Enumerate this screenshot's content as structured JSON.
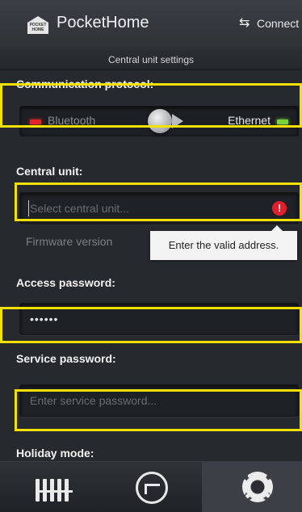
{
  "header": {
    "logo_text": "POCKET HOME",
    "app_title": "PocketHome",
    "connect_label": "Connect"
  },
  "subheader": {
    "title": "Central unit settings"
  },
  "protocol": {
    "label": "Communication protocol:",
    "option_left": "Bluetooth",
    "option_right": "Ethernet",
    "selected": "Ethernet"
  },
  "central_unit": {
    "label": "Central unit:",
    "placeholder": "Select central unit...",
    "firmware_label": "Firmware version",
    "error_tooltip": "Enter the valid address."
  },
  "access_password": {
    "label": "Access password:",
    "value": "••••••"
  },
  "service_password": {
    "label": "Service password:",
    "placeholder": "Enter service password..."
  },
  "holiday": {
    "label": "Holiday mode:"
  },
  "colors": {
    "highlight": "#f5e000",
    "error": "#e3202a",
    "led_off": "#e0262b",
    "led_on": "#7ad23a"
  },
  "bottom_nav": {
    "tabs": [
      {
        "icon": "radiator-icon",
        "active": false
      },
      {
        "icon": "gauge-icon",
        "active": false
      },
      {
        "icon": "gear-icon",
        "active": true
      }
    ]
  }
}
